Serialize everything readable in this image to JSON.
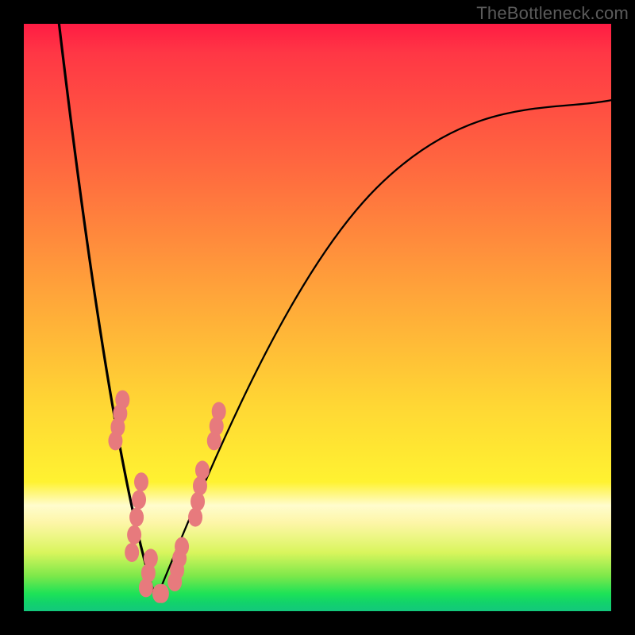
{
  "watermark": "TheBottleneck.com",
  "colors": {
    "frame": "#000000",
    "gradient_top": "#ff1c44",
    "gradient_mid": "#ffd734",
    "gradient_bottom": "#13c87c",
    "curve": "#000000",
    "marker": "#e77a7d"
  },
  "chart_data": {
    "type": "line",
    "title": "",
    "xlabel": "",
    "ylabel": "",
    "xlim": [
      0,
      1
    ],
    "ylim": [
      0,
      1
    ],
    "curve": {
      "minimum_x": 0.225,
      "minimum_y": 0.02,
      "left_top_x": 0.06,
      "left_top_y": 1.0,
      "right_top_x": 1.0,
      "right_top_y": 0.87
    },
    "marker_clusters": [
      {
        "x": 0.16,
        "y_start": 0.36,
        "y_end": 0.29,
        "count": 4
      },
      {
        "x": 0.19,
        "y_start": 0.22,
        "y_end": 0.1,
        "count": 5
      },
      {
        "x": 0.21,
        "y_start": 0.09,
        "y_end": 0.04,
        "count": 3
      },
      {
        "x": 0.235,
        "y_start": 0.03,
        "y_end": 0.03,
        "count": 2
      },
      {
        "x": 0.265,
        "y_start": 0.05,
        "y_end": 0.11,
        "count": 4
      },
      {
        "x": 0.3,
        "y_start": 0.16,
        "y_end": 0.24,
        "count": 4
      },
      {
        "x": 0.33,
        "y_start": 0.29,
        "y_end": 0.34,
        "count": 3
      }
    ]
  }
}
